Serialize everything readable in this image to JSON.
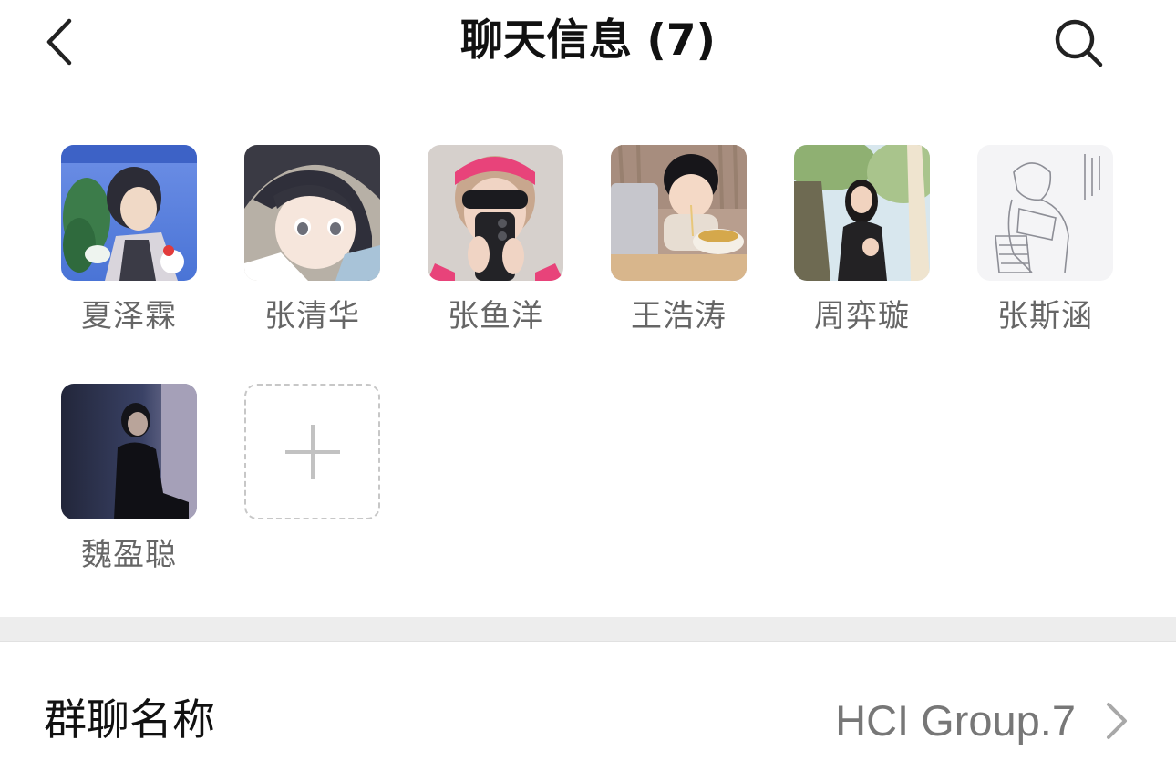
{
  "header": {
    "title": "聊天信息 (7)",
    "back_icon": "chevron-left-icon",
    "search_icon": "search-icon"
  },
  "members": [
    {
      "name": "夏泽霖",
      "avatar": "anime-boy-avatar"
    },
    {
      "name": "张清华",
      "avatar": "anime-girl-avatar"
    },
    {
      "name": "张鱼洋",
      "avatar": "girl-pink-headband-avatar"
    },
    {
      "name": "王浩涛",
      "avatar": "child-eating-noodles-avatar"
    },
    {
      "name": "周弈璇",
      "avatar": "woman-outdoors-avatar"
    },
    {
      "name": "张斯涵",
      "avatar": "pencil-sketch-avatar"
    },
    {
      "name": "魏盈聪",
      "avatar": "man-dark-portrait-avatar"
    }
  ],
  "add_member": {
    "icon": "plus-icon"
  },
  "group_name": {
    "label": "群聊名称",
    "value": "HCI Group.7",
    "icon": "chevron-right-icon"
  },
  "colors": {
    "background": "#ffffff",
    "separator": "#ededed",
    "secondary_text": "#777777",
    "member_name": "#666666"
  }
}
